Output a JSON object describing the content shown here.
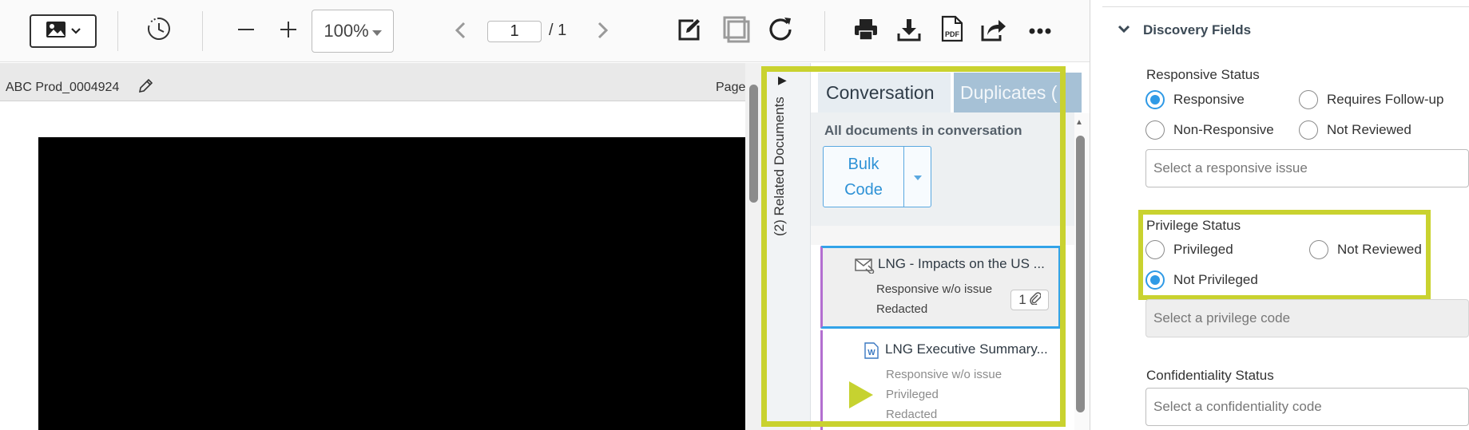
{
  "toolbar": {
    "image_menu_icon": "image-icon",
    "history_icon": "clock-history-icon",
    "zoom_out_icon": "minus-icon",
    "zoom_in_icon": "plus-icon",
    "zoom_value": "100%",
    "prev_icon": "chevron-left-icon",
    "page_value": "1",
    "page_total": "/ 1",
    "next_icon": "chevron-right-icon",
    "annotate_icon": "edit-icon",
    "redact_icon": "overlay-icon",
    "rotate_icon": "rotate-icon",
    "print_icon": "print-icon",
    "download_icon": "download-icon",
    "pdf_icon": "pdf-icon",
    "share_icon": "share-icon",
    "more_icon": "more-icon"
  },
  "viewer": {
    "doc_title": "ABC Prod_0004924",
    "page_label": "Page"
  },
  "related": {
    "strip_label": "(2) Related Documents",
    "arrow": "▶",
    "tabs": [
      {
        "label": "Conversation"
      },
      {
        "label": "Duplicates ("
      }
    ],
    "conversation_header": "All documents in conversation",
    "bulk_code_line1": "Bulk",
    "bulk_code_line2": "Code",
    "items": [
      {
        "title": "LNG - Impacts on the US ...",
        "icon": "email-attachment-icon",
        "lines": [
          "Responsive w/o issue",
          "Redacted"
        ],
        "attachments": "1"
      },
      {
        "title": "LNG Executive Summary...",
        "icon": "word-document-icon",
        "lines": [
          "Responsive w/o issue",
          "Privileged",
          "Redacted"
        ]
      }
    ]
  },
  "fields": {
    "title": "Discovery Fields",
    "responsive": {
      "label": "Responsive Status",
      "options": [
        {
          "label": "Responsive",
          "checked": true
        },
        {
          "label": "Requires Follow-up",
          "checked": false
        },
        {
          "label": "Non-Responsive",
          "checked": false
        },
        {
          "label": "Not Reviewed",
          "checked": false
        }
      ],
      "issue_placeholder": "Select a responsive issue"
    },
    "privilege": {
      "label": "Privilege Status",
      "options": [
        {
          "label": "Privileged",
          "checked": false
        },
        {
          "label": "Not Reviewed",
          "checked": false
        },
        {
          "label": "Not Privileged",
          "checked": true
        }
      ],
      "code_placeholder": "Select a privilege code"
    },
    "confidentiality": {
      "label": "Confidentiality Status",
      "code_placeholder": "Select a confidentiality code"
    }
  },
  "colors": {
    "accent_blue": "#2f9ae6",
    "highlight_yellow": "#c9d22f",
    "conversation_purple": "#b36fd0"
  }
}
